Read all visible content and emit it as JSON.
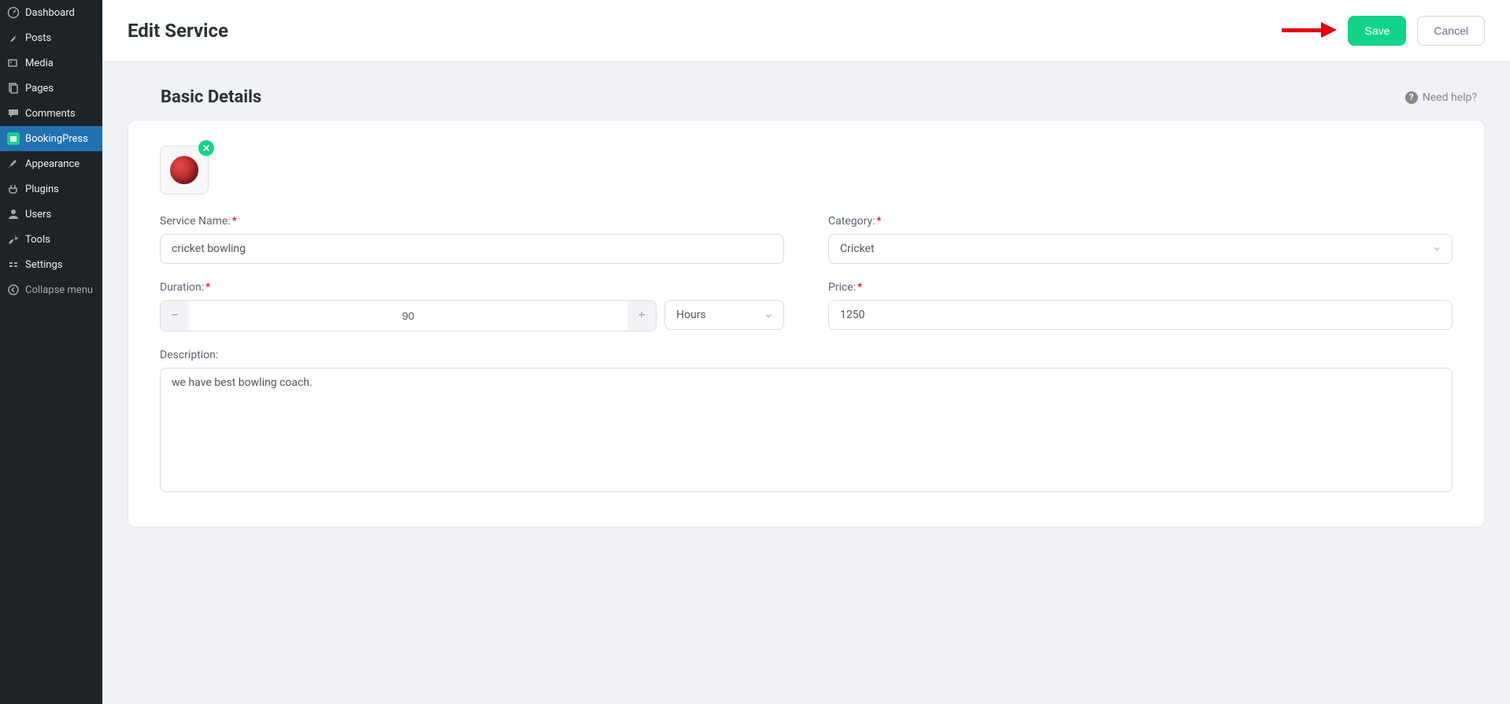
{
  "sidebar": {
    "items": [
      {
        "label": "Dashboard",
        "icon": "dashboard-icon"
      },
      {
        "label": "Posts",
        "icon": "pin-icon"
      },
      {
        "label": "Media",
        "icon": "media-icon"
      },
      {
        "label": "Pages",
        "icon": "pages-icon"
      },
      {
        "label": "Comments",
        "icon": "comments-icon"
      },
      {
        "label": "BookingPress",
        "icon": "bookingpress-icon",
        "active": true
      },
      {
        "label": "Appearance",
        "icon": "brush-icon"
      },
      {
        "label": "Plugins",
        "icon": "plug-icon"
      },
      {
        "label": "Users",
        "icon": "users-icon"
      },
      {
        "label": "Tools",
        "icon": "tools-icon"
      },
      {
        "label": "Settings",
        "icon": "settings-icon"
      }
    ],
    "collapse_label": "Collapse menu"
  },
  "topbar": {
    "title": "Edit Service",
    "save_label": "Save",
    "cancel_label": "Cancel"
  },
  "section": {
    "title": "Basic Details",
    "help_label": "Need help?"
  },
  "form": {
    "service_name": {
      "label": "Service Name:",
      "value": "cricket bowling"
    },
    "category": {
      "label": "Category:",
      "value": "Cricket"
    },
    "duration": {
      "label": "Duration:",
      "value": "90",
      "unit": "Hours"
    },
    "price": {
      "label": "Price:",
      "value": "1250"
    },
    "description": {
      "label": "Description:",
      "value": "we have best bowling coach."
    }
  }
}
